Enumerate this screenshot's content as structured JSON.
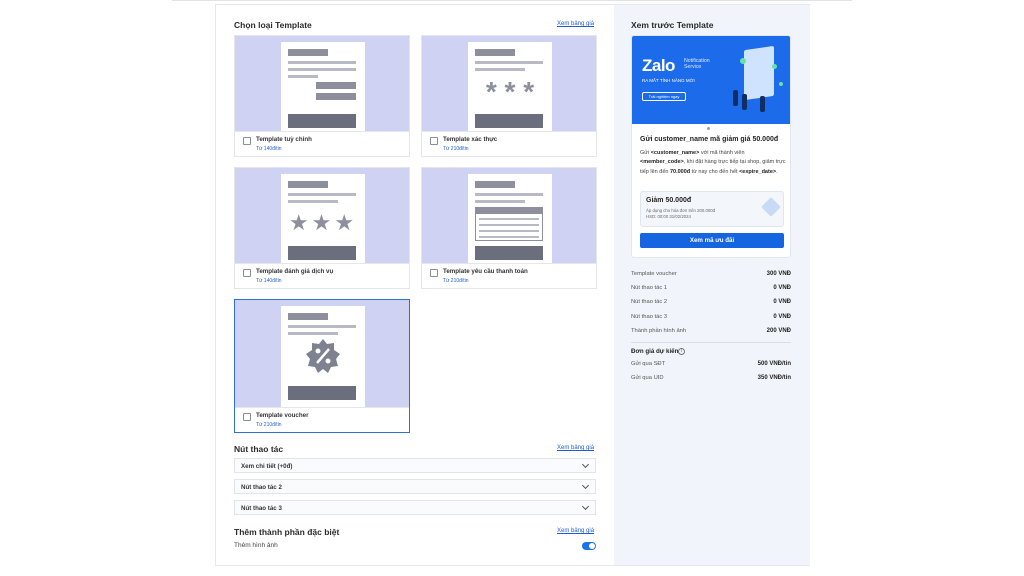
{
  "template_section": {
    "title": "Chọn loại Template",
    "pricing_link": "Xem bảng giá",
    "cards": [
      {
        "name": "Template tuỳ chỉnh",
        "price": "Từ 140đ/tin"
      },
      {
        "name": "Template xác thực",
        "price": "Từ 210đ/tin"
      },
      {
        "name": "Template đánh giá dịch vụ",
        "price": "Từ 140đ/tin"
      },
      {
        "name": "Template yêu cầu thanh toán",
        "price": "Từ 210đ/tin"
      },
      {
        "name": "Template voucher",
        "price": "Từ 210đ/tin"
      }
    ],
    "auth_glyphs": "* * *",
    "rating_glyphs": "★★★"
  },
  "action_section": {
    "title": "Nút thao tác",
    "pricing_link": "Xem bảng giá",
    "dropdowns": [
      {
        "label": "Xem chi tiết (+0đ)"
      },
      {
        "label": "Nút thao tác 2"
      },
      {
        "label": "Nút thao tác 3"
      }
    ]
  },
  "extra_section": {
    "title": "Thêm thành phần đặc biệt",
    "pricing_link": "Xem bảng giá",
    "toggle_label": "Thêm hình ảnh",
    "toggle_on": true
  },
  "preview": {
    "title": "Xem trước Template",
    "banner": {
      "brand": "Zalo",
      "service": "Notification Service",
      "tagline": "RA MẮT TÍNH NĂNG MỚI",
      "button": "Trải nghiệm ngay"
    },
    "message_title": "Gửi customer_name mã giảm giá 50.000đ",
    "message": {
      "p1": "Gửi ",
      "t1": "<customer_name>",
      "p2": " với mã thành viên ",
      "t2": "<member_code>",
      "p3": ", khi đặt hàng trực tiếp tại shop, giảm trực tiếp lên đến ",
      "t3": "70.000đ",
      "p4": " từ nay cho đến hết ",
      "t4": "<expire_date>",
      "p5": "."
    },
    "coupon": {
      "title": "Giảm 50.000đ",
      "line1": "Áp dụng cho hóa đơn trên 200.000đ",
      "line2": "HSD: 00:00 31/02/2024"
    },
    "cta": "Xem mã ưu đãi"
  },
  "costs": [
    {
      "label": "Template voucher",
      "value": "300 VNĐ"
    },
    {
      "label": "Nút thao tác 1",
      "value": "0 VNĐ"
    },
    {
      "label": "Nút thao tác 2",
      "value": "0 VNĐ"
    },
    {
      "label": "Nút thao tác 3",
      "value": "0 VNĐ"
    },
    {
      "label": "Thành phần hình ảnh",
      "value": "200 VNĐ"
    }
  ],
  "estimate": {
    "title": "Đơn giá dự kiến",
    "info_glyph": "i",
    "rows": [
      {
        "label": "Gửi qua SĐT",
        "value": "500 VNĐ/tin"
      },
      {
        "label": "Gửi qua UID",
        "value": "350 VNĐ/tin"
      }
    ]
  },
  "colors": {
    "accent": "#1565e0",
    "thumb_bg": "#cfd2f3",
    "panel_bg": "#f1f4fa"
  }
}
